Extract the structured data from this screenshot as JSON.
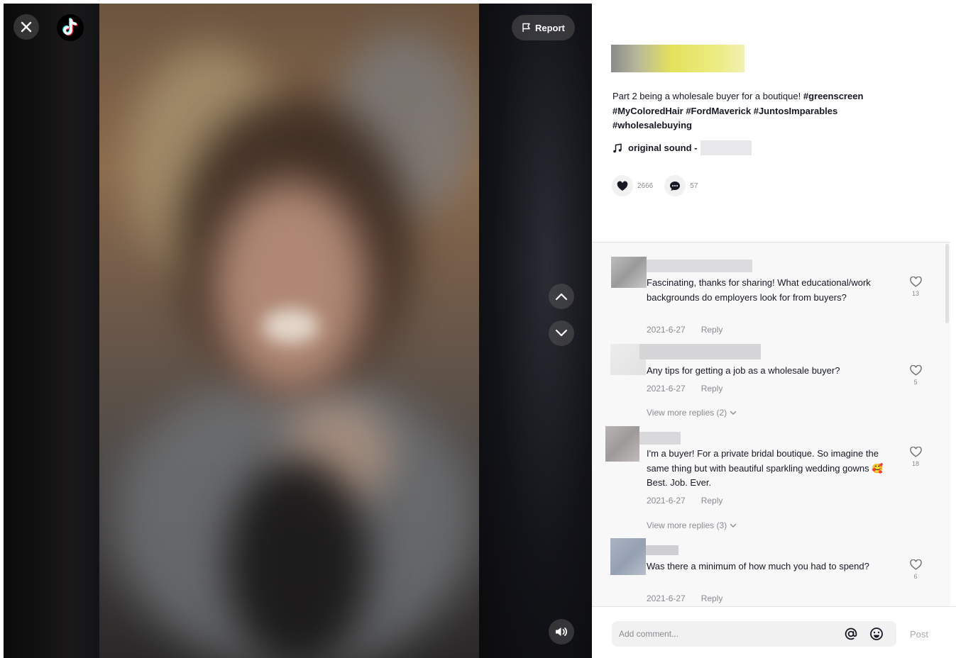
{
  "player": {
    "report_label": "Report"
  },
  "post": {
    "caption_text": "Part 2 being a wholesale buyer for a boutique! ",
    "hashtags": [
      "#greenscreen",
      "#MyColoredHair",
      "#FordMaverick",
      "#JuntosImparables",
      "#wholesalebuying"
    ],
    "music_label": "original sound -",
    "likes": "2666",
    "comments": "57"
  },
  "comments": [
    {
      "text": "Fascinating, thanks for sharing! What educational/work backgrounds do employers look for from buyers?",
      "date": "2021-6-27",
      "reply_label": "Reply",
      "likes": "13"
    },
    {
      "text": "Any tips for getting a job as a wholesale buyer?",
      "date": "2021-6-27",
      "reply_label": "Reply",
      "likes": "5",
      "more_replies": "View more replies (2)"
    },
    {
      "text_before_emoji": "I'm a buyer! For a private bridal boutique. So imagine the same thing but with beautiful sparkling wedding gowns ",
      "emoji": "🥰",
      "text_after_emoji": " Best. Job. Ever.",
      "date": "2021-6-27",
      "reply_label": "Reply",
      "likes": "18",
      "more_replies": "View more replies (3)"
    },
    {
      "text": "Was there a minimum of how much you had to spend?",
      "date": "2021-6-27",
      "reply_label": "Reply",
      "likes": "6"
    }
  ],
  "composer": {
    "placeholder": "Add comment...",
    "post_label": "Post"
  },
  "colors": {
    "text": "#161823",
    "muted": "#8a8b91",
    "comments_bg": "#f8f8f8"
  }
}
